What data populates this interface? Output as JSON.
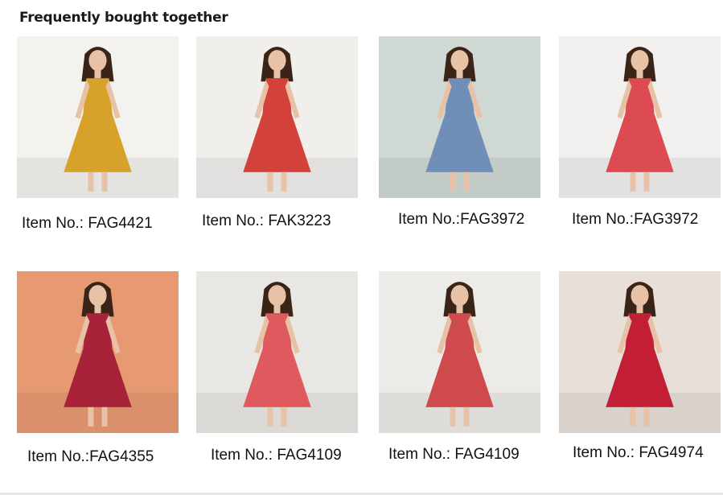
{
  "section": {
    "title": "Frequently bought together"
  },
  "products": [
    {
      "item_no": "Item No.: FAG4421",
      "dress_color": "#d6a22a",
      "backdrop": "#f4f2ee"
    },
    {
      "item_no": "Item No.: FAK3223",
      "dress_color": "#d2413a",
      "backdrop": "#f1efec"
    },
    {
      "item_no": "Item No.:FAG3972",
      "dress_color": "#6f8fb8",
      "backdrop": "#cfd8d2"
    },
    {
      "item_no": "Item No.:FAG3972",
      "dress_color": "#dc4a52",
      "backdrop": "#f2f0ee"
    },
    {
      "item_no": "Item No.:FAG4355",
      "dress_color": "#a8233a",
      "backdrop": "#e79a72"
    },
    {
      "item_no": "Item No.: FAG4109",
      "dress_color": "#df5a5e",
      "backdrop": "#e9e7e3"
    },
    {
      "item_no": "Item No.: FAG4109",
      "dress_color": "#cf4a4c",
      "backdrop": "#ecebe8"
    },
    {
      "item_no": "Item No.: FAG4974",
      "dress_color": "#c21f37",
      "backdrop": "#e7dfd8"
    }
  ]
}
